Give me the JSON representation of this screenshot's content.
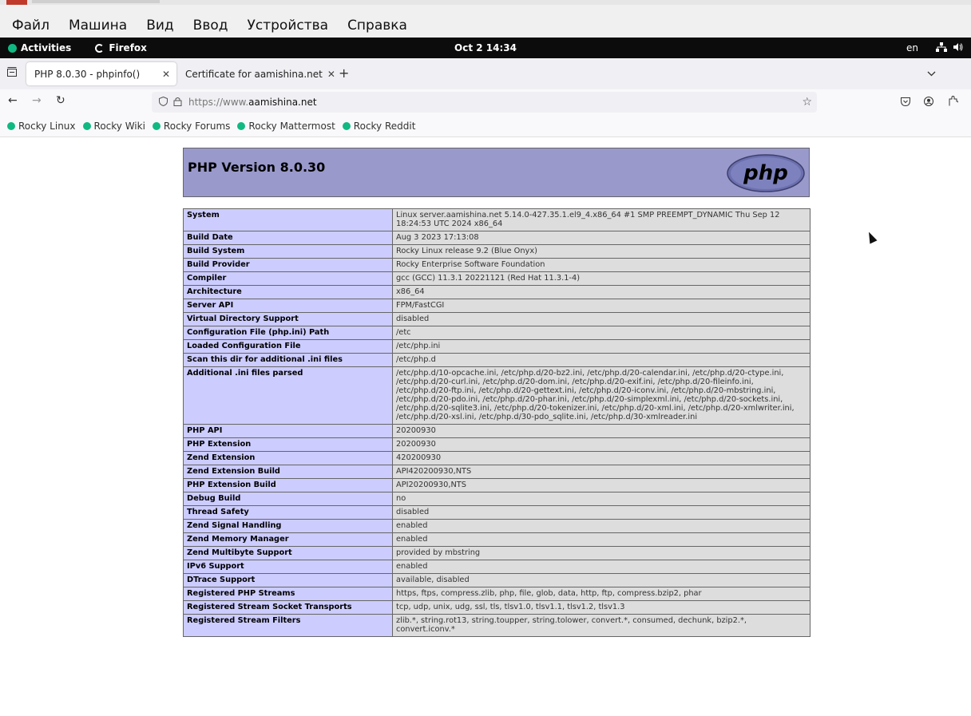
{
  "vbox_menu": [
    "Файл",
    "Машина",
    "Вид",
    "Ввод",
    "Устройства",
    "Справка"
  ],
  "gnome": {
    "activities": "Activities",
    "app": "Firefox",
    "clock": "Oct 2 14:34",
    "lang": "en"
  },
  "tabs": [
    {
      "title": "PHP 8.0.30 - phpinfo()"
    },
    {
      "title": "Certificate for aamishina.net"
    }
  ],
  "nav": {
    "url_prefix": "https://www.",
    "url_domain": "aamishina.net"
  },
  "bookmarks": [
    "Rocky Linux",
    "Rocky Wiki",
    "Rocky Forums",
    "Rocky Mattermost",
    "Rocky Reddit"
  ],
  "php": {
    "title": "PHP Version 8.0.30",
    "logo_text": "php",
    "rows": [
      {
        "k": "System",
        "v": "Linux server.aamishina.net 5.14.0-427.35.1.el9_4.x86_64 #1 SMP PREEMPT_DYNAMIC Thu Sep 12 18:24:53 UTC 2024 x86_64"
      },
      {
        "k": "Build Date",
        "v": "Aug 3 2023 17:13:08"
      },
      {
        "k": "Build System",
        "v": "Rocky Linux release 9.2 (Blue Onyx)"
      },
      {
        "k": "Build Provider",
        "v": "Rocky Enterprise Software Foundation"
      },
      {
        "k": "Compiler",
        "v": "gcc (GCC) 11.3.1 20221121 (Red Hat 11.3.1-4)"
      },
      {
        "k": "Architecture",
        "v": "x86_64"
      },
      {
        "k": "Server API",
        "v": "FPM/FastCGI"
      },
      {
        "k": "Virtual Directory Support",
        "v": "disabled"
      },
      {
        "k": "Configuration File (php.ini) Path",
        "v": "/etc"
      },
      {
        "k": "Loaded Configuration File",
        "v": "/etc/php.ini"
      },
      {
        "k": "Scan this dir for additional .ini files",
        "v": "/etc/php.d"
      },
      {
        "k": "Additional .ini files parsed",
        "v": "/etc/php.d/10-opcache.ini, /etc/php.d/20-bz2.ini, /etc/php.d/20-calendar.ini, /etc/php.d/20-ctype.ini, /etc/php.d/20-curl.ini, /etc/php.d/20-dom.ini, /etc/php.d/20-exif.ini, /etc/php.d/20-fileinfo.ini, /etc/php.d/20-ftp.ini, /etc/php.d/20-gettext.ini, /etc/php.d/20-iconv.ini, /etc/php.d/20-mbstring.ini, /etc/php.d/20-pdo.ini, /etc/php.d/20-phar.ini, /etc/php.d/20-simplexml.ini, /etc/php.d/20-sockets.ini, /etc/php.d/20-sqlite3.ini, /etc/php.d/20-tokenizer.ini, /etc/php.d/20-xml.ini, /etc/php.d/20-xmlwriter.ini, /etc/php.d/20-xsl.ini, /etc/php.d/30-pdo_sqlite.ini, /etc/php.d/30-xmlreader.ini"
      },
      {
        "k": "PHP API",
        "v": "20200930"
      },
      {
        "k": "PHP Extension",
        "v": "20200930"
      },
      {
        "k": "Zend Extension",
        "v": "420200930"
      },
      {
        "k": "Zend Extension Build",
        "v": "API420200930,NTS"
      },
      {
        "k": "PHP Extension Build",
        "v": "API20200930,NTS"
      },
      {
        "k": "Debug Build",
        "v": "no"
      },
      {
        "k": "Thread Safety",
        "v": "disabled"
      },
      {
        "k": "Zend Signal Handling",
        "v": "enabled"
      },
      {
        "k": "Zend Memory Manager",
        "v": "enabled"
      },
      {
        "k": "Zend Multibyte Support",
        "v": "provided by mbstring"
      },
      {
        "k": "IPv6 Support",
        "v": "enabled"
      },
      {
        "k": "DTrace Support",
        "v": "available, disabled"
      },
      {
        "k": "Registered PHP Streams",
        "v": "https, ftps, compress.zlib, php, file, glob, data, http, ftp, compress.bzip2, phar"
      },
      {
        "k": "Registered Stream Socket Transports",
        "v": "tcp, udp, unix, udg, ssl, tls, tlsv1.0, tlsv1.1, tlsv1.2, tlsv1.3"
      },
      {
        "k": "Registered Stream Filters",
        "v": "zlib.*, string.rot13, string.toupper, string.tolower, convert.*, consumed, dechunk, bzip2.*, convert.iconv.*"
      }
    ]
  }
}
